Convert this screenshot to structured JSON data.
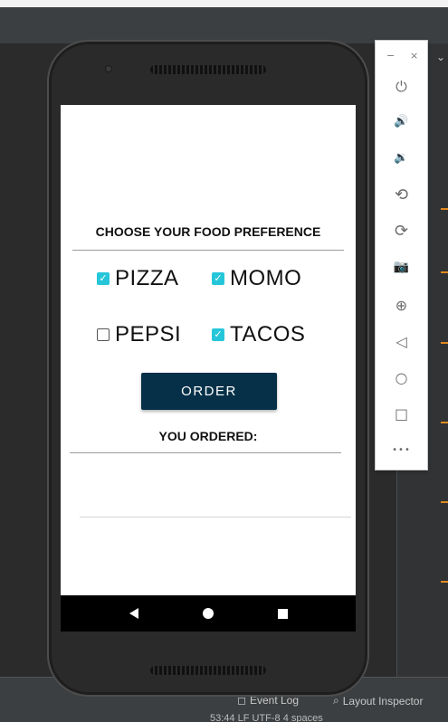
{
  "screen": {
    "heading": "CHOOSE YOUR FOOD  PREFERENCE",
    "checkboxes": [
      {
        "label": "PIZZA",
        "checked": true
      },
      {
        "label": "MOMO",
        "checked": true
      },
      {
        "label": "PEPSI",
        "checked": false
      },
      {
        "label": "TACOS",
        "checked": true
      }
    ],
    "order_button": "ORDER",
    "you_ordered": "YOU ORDERED:"
  },
  "check_glyph": "✓",
  "emulator_toolbar": {
    "minimize": "−",
    "close": "×",
    "icons": [
      "power-icon",
      "volume-up-icon",
      "volume-down-icon",
      "rotate-left-icon",
      "rotate-right-icon",
      "camera-icon",
      "zoom-icon",
      "back-icon",
      "home-icon",
      "overview-icon",
      "more-icon"
    ],
    "glyphs": {
      "power": "⏻",
      "vol_up": "🔊",
      "vol_down": "🔉",
      "rotate_left": "⟲",
      "rotate_right": "⟳",
      "camera": "📷",
      "zoom": "⊕",
      "back": "◁",
      "home": "○",
      "overview": "□",
      "more": "•••"
    }
  },
  "ide": {
    "event_log": "Event Log",
    "layout_inspector": "Layout Inspector",
    "status": "53:44  LF  UTF-8  4 spaces"
  },
  "colors": {
    "accent": "#26c6da",
    "button": "#053048",
    "ide_bg": "#2b2b2b",
    "marker": "#e08a1e"
  }
}
